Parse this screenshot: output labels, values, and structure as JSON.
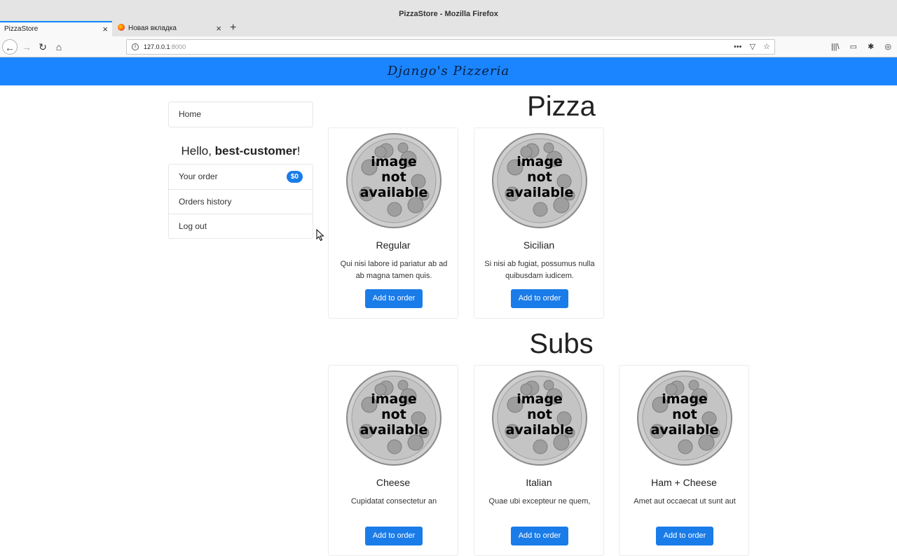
{
  "browser": {
    "window_title": "PizzaStore - Mozilla Firefox",
    "tabs": [
      {
        "label": "PizzaStore"
      },
      {
        "label": "Новая вкладка"
      }
    ],
    "url_host": "127.0.0.1",
    "url_port": ":8000"
  },
  "site": {
    "brand": "Django's Pizzeria"
  },
  "sidebar": {
    "home": "Home",
    "greeting_prefix": "Hello, ",
    "username": "best-customer",
    "greeting_suffix": "!",
    "order_label": "Your order",
    "order_total": "$0",
    "history": "Orders history",
    "logout": "Log out"
  },
  "sections": {
    "pizza": {
      "title": "Pizza",
      "items": [
        {
          "name": "Regular",
          "desc": "Qui nisi labore id pariatur ab ad ab magna tamen quis.",
          "button": "Add to order"
        },
        {
          "name": "Sicilian",
          "desc": "Si nisi ab fugiat, possumus nulla quibusdam iudicem.",
          "button": "Add to order"
        }
      ]
    },
    "subs": {
      "title": "Subs",
      "items": [
        {
          "name": "Cheese",
          "desc": "Cupidatat consectetur an",
          "button": "Add to order"
        },
        {
          "name": "Italian",
          "desc": "Quae ubi excepteur ne quem,",
          "button": "Add to order"
        },
        {
          "name": "Ham + Cheese",
          "desc": "Amet aut occaecat ut sunt aut",
          "button": "Add to order"
        }
      ]
    }
  },
  "placeholder_image_text": [
    "image",
    "not",
    "available"
  ],
  "colors": {
    "header": "#1a85ff",
    "button": "#1a7ce8",
    "placeholder": "#c8c8c8"
  }
}
